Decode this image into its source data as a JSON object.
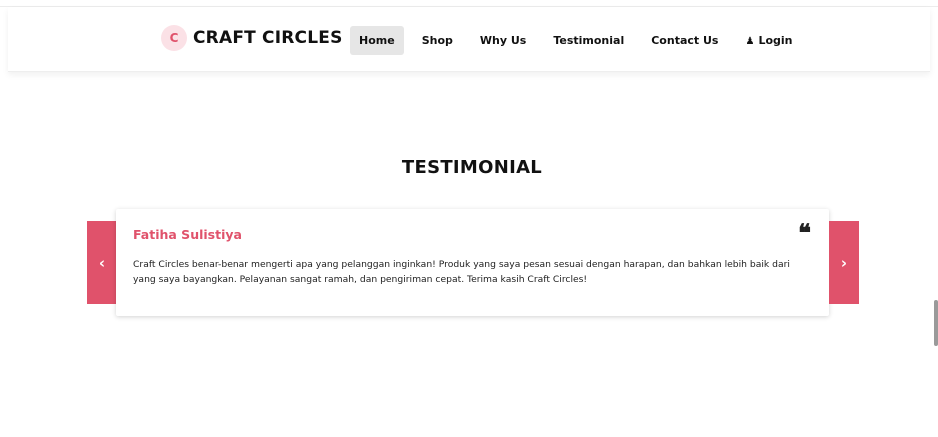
{
  "header": {
    "brand": {
      "logo_letter": "C",
      "name": "CRAFT CIRCLES"
    },
    "nav": [
      {
        "label": "Home",
        "active": true
      },
      {
        "label": "Shop",
        "active": false
      },
      {
        "label": "Why Us",
        "active": false
      },
      {
        "label": "Testimonial",
        "active": false
      },
      {
        "label": "Contact Us",
        "active": false
      }
    ],
    "login": {
      "label": "Login",
      "icon": "user-icon"
    }
  },
  "testimonial": {
    "title": "TESTIMONIAL",
    "author": "Fatiha Sulistiya",
    "quote_icon": "quote-icon",
    "text": "Craft Circles benar-benar mengerti apa yang pelanggan inginkan! Produk yang saya pesan sesuai dengan harapan, dan bahkan lebih baik dari yang saya bayangkan. Pelayanan sangat ramah, dan pengiriman cepat. Terima kasih Craft Circles!",
    "prev_symbol": "‹",
    "next_symbol": "›"
  },
  "colors": {
    "accent": "#e0526b",
    "active_nav_bg": "#e6e6e6",
    "text": "#111111"
  }
}
